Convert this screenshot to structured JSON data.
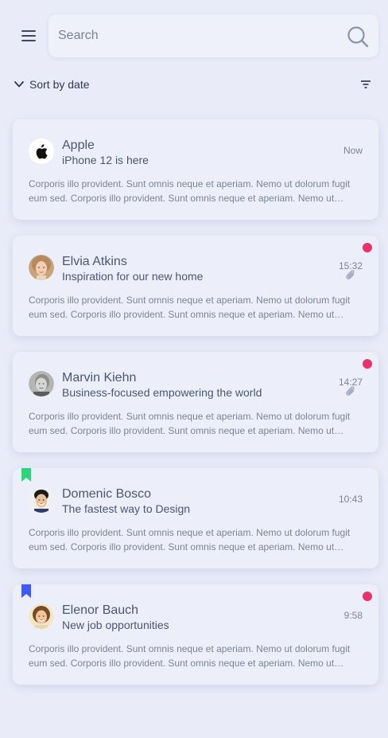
{
  "search": {
    "placeholder": "Search"
  },
  "sort": {
    "label": "Sort by date"
  },
  "colors": {
    "unread": "#e8336a",
    "bookmark_green": "#2ed47a",
    "bookmark_blue": "#3d5afe"
  },
  "mails": [
    {
      "sender": "Apple",
      "subject": "iPhone 12 is here",
      "time": "Now",
      "preview": "Corporis illo provident. Sunt omnis neque et aperiam. Nemo ut dolorum fugit eum sed. Corporis illo provident. Sunt omnis neque et aperiam. Nemo ut dolorum fugit eum sed.",
      "avatar": "apple-logo",
      "unread": false,
      "attachment": false,
      "bookmark": null
    },
    {
      "sender": "Elvia Atkins",
      "subject": "Inspiration for our new home",
      "time": "15:32",
      "preview": "Corporis illo provident. Sunt omnis neque et aperiam. Nemo ut dolorum fugit eum sed. Corporis illo provident. Sunt omnis neque et aperiam. Nemo ut dolorum fugit eum sed.",
      "avatar": "person-photo",
      "unread": true,
      "attachment": true,
      "bookmark": null
    },
    {
      "sender": "Marvin Kiehn",
      "subject": "Business-focused empowering the world",
      "time": "14:27",
      "preview": "Corporis illo provident. Sunt omnis neque et aperiam. Nemo ut dolorum fugit eum sed. Corporis illo provident. Sunt omnis neque et aperiam. Nemo ut dolorum fugit eum sed.",
      "avatar": "person-photo",
      "unread": true,
      "attachment": true,
      "bookmark": null
    },
    {
      "sender": "Domenic Bosco",
      "subject": "The fastest way to Design",
      "time": "10:43",
      "preview": "Corporis illo provident. Sunt omnis neque et aperiam. Nemo ut dolorum fugit eum sed. Corporis illo provident. Sunt omnis neque et aperiam. Nemo ut dolorum fugit eum sed.",
      "avatar": "person-photo",
      "unread": false,
      "attachment": false,
      "bookmark": "green"
    },
    {
      "sender": "Elenor Bauch",
      "subject": "New job opportunities",
      "time": "9:58",
      "preview": "Corporis illo provident. Sunt omnis neque et aperiam. Nemo ut dolorum fugit eum sed. Corporis illo provident. Sunt omnis neque et aperiam. Nemo ut dolorum fugit eum sed.",
      "avatar": "person-photo",
      "unread": true,
      "attachment": false,
      "bookmark": "blue"
    }
  ]
}
